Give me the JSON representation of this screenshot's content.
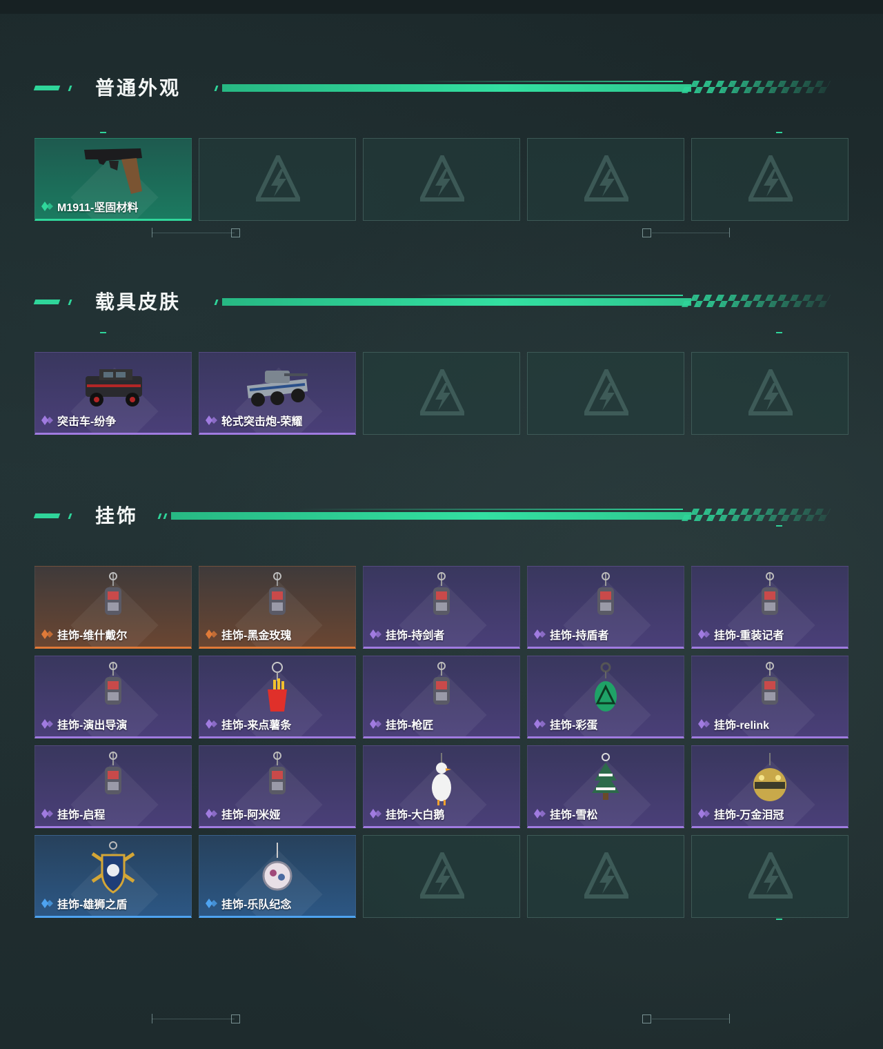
{
  "sections": [
    {
      "title": "普通外观",
      "items": [
        {
          "label": "M1911-坚固材料",
          "rarity": "green",
          "icon": "pistol-icon"
        },
        {
          "empty": true
        },
        {
          "empty": true
        },
        {
          "empty": true
        },
        {
          "empty": true
        }
      ]
    },
    {
      "title": "载具皮肤",
      "items": [
        {
          "label": "突击车-纷争",
          "rarity": "purple",
          "icon": "assault-vehicle-icon"
        },
        {
          "label": "轮式突击炮-荣耀",
          "rarity": "purple",
          "icon": "wheeled-assault-gun-icon"
        },
        {
          "empty": true
        },
        {
          "empty": true
        },
        {
          "empty": true
        }
      ]
    },
    {
      "title": "挂饰",
      "items": [
        {
          "label": "挂饰-维什戴尔",
          "rarity": "orange",
          "icon": "charm-icon"
        },
        {
          "label": "挂饰-黑金玫瑰",
          "rarity": "orange",
          "icon": "charm-icon"
        },
        {
          "label": "挂饰-持剑者",
          "rarity": "purple",
          "icon": "charm-icon"
        },
        {
          "label": "挂饰-持盾者",
          "rarity": "purple",
          "icon": "charm-icon"
        },
        {
          "label": "挂饰-重装记者",
          "rarity": "purple",
          "icon": "charm-icon"
        },
        {
          "label": "挂饰-演出导演",
          "rarity": "purple",
          "icon": "charm-icon"
        },
        {
          "label": "挂饰-来点薯条",
          "rarity": "purple",
          "icon": "fries-charm-icon"
        },
        {
          "label": "挂饰-枪匠",
          "rarity": "purple",
          "icon": "charm-icon"
        },
        {
          "label": "挂饰-彩蛋",
          "rarity": "purple",
          "icon": "egg-charm-icon"
        },
        {
          "label": "挂饰-relink",
          "rarity": "purple",
          "icon": "charm-icon"
        },
        {
          "label": "挂饰-启程",
          "rarity": "purple",
          "icon": "charm-icon"
        },
        {
          "label": "挂饰-阿米娅",
          "rarity": "purple",
          "icon": "charm-icon"
        },
        {
          "label": "挂饰-大白鹅",
          "rarity": "purple",
          "icon": "goose-charm-icon"
        },
        {
          "label": "挂饰-雪松",
          "rarity": "purple",
          "icon": "tree-charm-icon"
        },
        {
          "label": "挂饰-万金泪冠",
          "rarity": "purple",
          "icon": "crown-charm-icon"
        },
        {
          "label": "挂饰-雄狮之盾",
          "rarity": "blue",
          "icon": "shield-charm-icon"
        },
        {
          "label": "挂饰-乐队纪念",
          "rarity": "blue",
          "icon": "badge-charm-icon"
        },
        {
          "empty": true
        },
        {
          "empty": true
        },
        {
          "empty": true
        }
      ]
    }
  ],
  "colors": {
    "accent": "#2fd59a",
    "green": "#30d79b",
    "purple": "#a07be0",
    "orange": "#e07a38",
    "blue": "#4ea3f0"
  }
}
